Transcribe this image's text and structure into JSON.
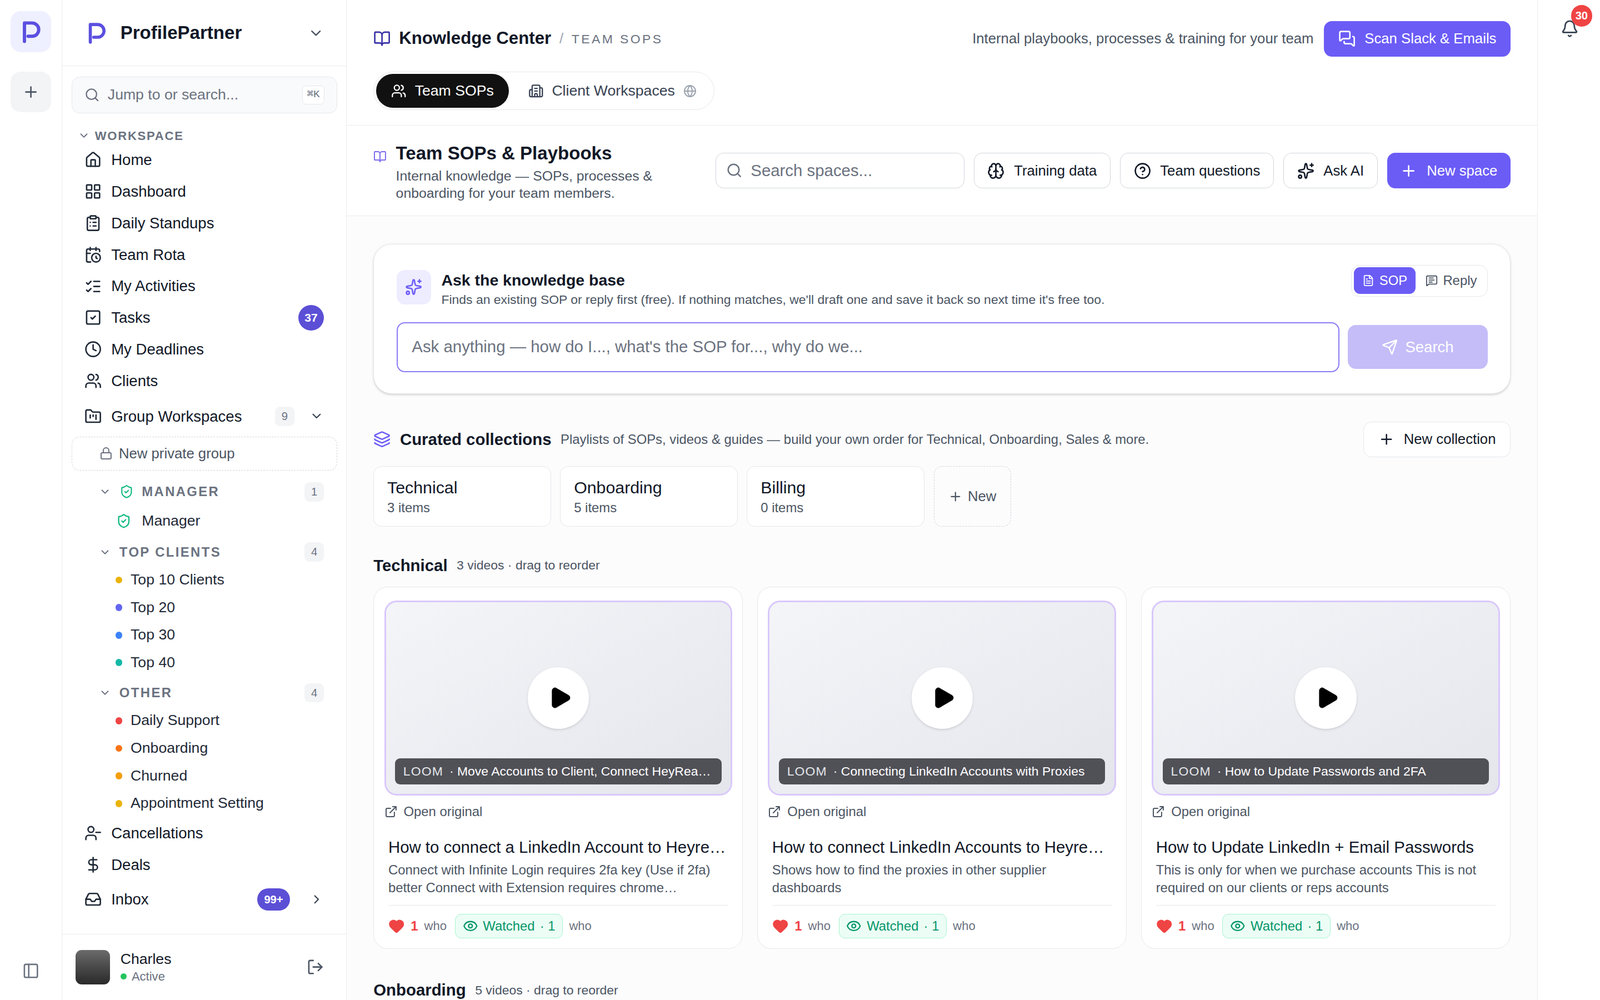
{
  "app": {
    "name": "ProfilePartner"
  },
  "sidebar": {
    "search": {
      "placeholder": "Jump to or search...",
      "shortcut": "⌘K"
    },
    "section": {
      "label": "WORKSPACE",
      "expanded": true
    },
    "items": [
      {
        "label": "Home"
      },
      {
        "label": "Dashboard"
      },
      {
        "label": "Daily Standups"
      },
      {
        "label": "Team Rota"
      },
      {
        "label": "My Activities"
      },
      {
        "label": "Tasks",
        "badge": "37"
      },
      {
        "label": "My Deadlines"
      },
      {
        "label": "Clients"
      }
    ],
    "group_workspaces": {
      "label": "Group Workspaces",
      "count": "9",
      "expanded": true,
      "new_group": "New private group",
      "groups": [
        {
          "label": "MANAGER",
          "count": "1",
          "kind": "role",
          "expanded": true,
          "items": [
            {
              "label": "Manager",
              "kind": "role"
            }
          ]
        },
        {
          "label": "TOP CLIENTS",
          "count": "4",
          "kind": "list",
          "expanded": true,
          "items": [
            {
              "label": "Top 10 Clients",
              "kind": "dot",
              "color": "#eab308"
            },
            {
              "label": "Top 20",
              "kind": "dot",
              "color": "#6366f1"
            },
            {
              "label": "Top 30",
              "kind": "dot",
              "color": "#3b82f6"
            },
            {
              "label": "Top 40",
              "kind": "dot",
              "color": "#14b8a6"
            }
          ]
        },
        {
          "label": "OTHER",
          "count": "4",
          "kind": "list",
          "expanded": true,
          "items": [
            {
              "label": "Daily Support",
              "kind": "dot",
              "color": "#ef4444"
            },
            {
              "label": "Onboarding",
              "kind": "dot",
              "color": "#f97316"
            },
            {
              "label": "Churned",
              "kind": "dot",
              "color": "#f59e0b"
            },
            {
              "label": "Appointment Setting",
              "kind": "dot",
              "color": "#eab308"
            }
          ]
        }
      ]
    },
    "more_items": [
      {
        "label": "Cancellations"
      },
      {
        "label": "Deals"
      },
      {
        "label": "Inbox",
        "badge": "99+",
        "expanded": false
      }
    ],
    "user": {
      "name": "Charles",
      "status": "Active",
      "online": true
    }
  },
  "notifications": {
    "count": "30"
  },
  "header": {
    "title": "Knowledge Center",
    "separator": "/",
    "current": "TEAM SOPS",
    "tagline": "Internal playbooks, processes & training for your team",
    "scan_button": "Scan Slack & Emails"
  },
  "tabs": [
    {
      "label": "Team SOPs",
      "selected": true
    },
    {
      "label": "Client Workspaces",
      "selected": false
    }
  ],
  "section": {
    "title": "Team SOPs & Playbooks",
    "subtitle": "Internal knowledge — SOPs, processes & onboarding for your team members.",
    "search_placeholder": "Search spaces...",
    "buttons": [
      {
        "label": "Training data",
        "kind": "outline"
      },
      {
        "label": "Team questions",
        "kind": "outline"
      },
      {
        "label": "Ask AI",
        "kind": "outline"
      },
      {
        "label": "New space",
        "kind": "primary"
      }
    ]
  },
  "ask": {
    "title": "Ask the knowledge base",
    "subtitle": "Finds an existing SOP or reply first (free). If nothing matches, we'll draft one and save it back so next time it's free too.",
    "modes": [
      {
        "label": "SOP",
        "selected": true
      },
      {
        "label": "Reply",
        "selected": false
      }
    ],
    "placeholder": "Ask anything — how do I..., what's the SOP for..., why do we...",
    "button": {
      "label": "Search",
      "disabled": true
    }
  },
  "collections": {
    "title": "Curated collections",
    "subtitle": "Playlists of SOPs, videos & guides — build your own order for Technical, Onboarding, Sales & more.",
    "new_button": "New collection",
    "items": [
      {
        "name": "Technical",
        "count": "3 items"
      },
      {
        "name": "Onboarding",
        "count": "5 items"
      },
      {
        "name": "Billing",
        "count": "0 items"
      }
    ],
    "add_label": "New"
  },
  "playlists": [
    {
      "title": "Technical",
      "meta": "3 videos · drag to reorder",
      "videos": [
        {
          "source": "LOOM",
          "caption": "· Move Accounts to Client, Connect HeyRea…",
          "link": "Open original",
          "title": "How to connect a LinkedIn Account to Heyre…",
          "description": "Connect with Infinite Login requires 2fa key (Use if 2fa) better Connect with Extension requires chrome…",
          "likes": "1",
          "likes_label": "who",
          "liked": true,
          "watched_label": "Watched",
          "watched_count": "· 1",
          "watched_by_label": "who",
          "watched": true
        },
        {
          "source": "LOOM",
          "caption": "· Connecting LinkedIn Accounts with Proxies",
          "link": "Open original",
          "title": "How to connect LinkedIn Accounts to Heyre…",
          "description": "Shows how to find the proxies in other supplier dashboards",
          "likes": "1",
          "likes_label": "who",
          "liked": true,
          "watched_label": "Watched",
          "watched_count": "· 1",
          "watched_by_label": "who",
          "watched": true
        },
        {
          "source": "LOOM",
          "caption": "· How to Update Passwords and 2FA",
          "link": "Open original",
          "title": "How to Update LinkedIn + Email Passwords",
          "description": "This is only for when we purchase accounts This is not required on our clients or reps accounts",
          "likes": "1",
          "likes_label": "who",
          "liked": true,
          "watched_label": "Watched",
          "watched_count": "· 1",
          "watched_by_label": "who",
          "watched": true
        }
      ]
    },
    {
      "title": "Onboarding",
      "meta": "5 videos · drag to reorder",
      "videos": []
    }
  ]
}
